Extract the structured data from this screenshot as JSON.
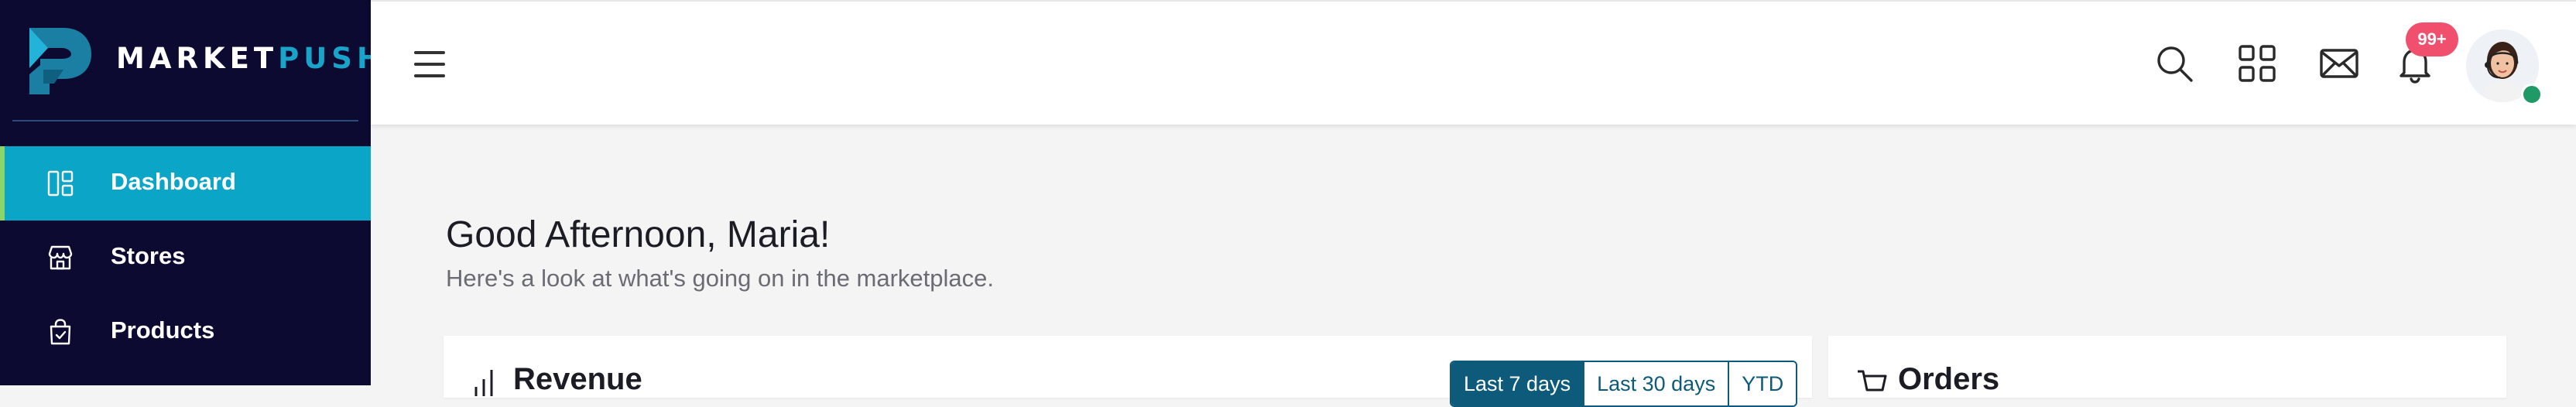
{
  "brand": {
    "name_part1": "MARKET",
    "name_part2": "PUSH"
  },
  "sidebar": {
    "items": [
      {
        "label": "Dashboard",
        "icon": "dashboard-icon",
        "active": true
      },
      {
        "label": "Stores",
        "icon": "store-icon",
        "active": false
      },
      {
        "label": "Products",
        "icon": "bag-icon",
        "active": false
      }
    ]
  },
  "header": {
    "icons": [
      "menu-icon",
      "search-icon",
      "apps-grid-icon",
      "mail-icon",
      "bell-icon"
    ],
    "notification_badge": "99+",
    "user_status": "online"
  },
  "main": {
    "greeting": "Good Afternoon, Maria!",
    "subtitle": "Here's a look at what's going on in the marketplace.",
    "revenue_card": {
      "title": "Revenue",
      "ranges": [
        "Last 7 days",
        "Last 30 days",
        "YTD"
      ],
      "selected_range": "Last 7 days"
    },
    "orders_card": {
      "title": "Orders"
    }
  },
  "colors": {
    "sidebar_bg": "#0c0a30",
    "active_item_bg": "#0ba5c7",
    "active_indicator": "#8bd66b",
    "brand_accent": "#1aa3c8",
    "badge": "#f0506e",
    "status_online": "#1f9a66",
    "range_button": "#0d5a7a"
  }
}
